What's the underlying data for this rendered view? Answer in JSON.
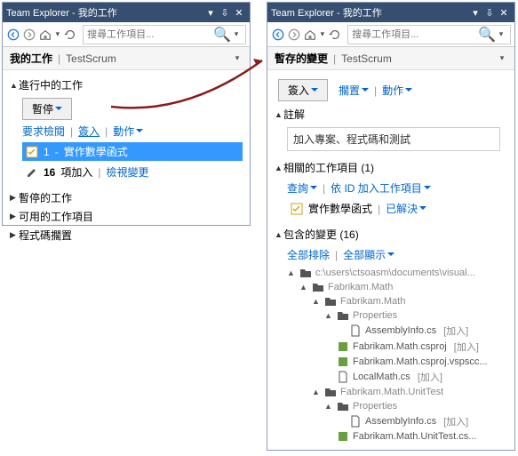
{
  "left": {
    "title": "Team Explorer - 我的工作",
    "search_placeholder": "搜尋工作項目...",
    "page_title": "我的工作",
    "context": "TestScrum",
    "in_progress": {
      "label": "進行中的工作",
      "suspend_btn": "暫停",
      "request_review": "要求檢閱",
      "checkin": "簽入",
      "actions": "動作",
      "item_id": "1",
      "item_title": "實作數學函式",
      "adds_count": "16",
      "adds_label": "項加入",
      "view_changes": "檢視變更"
    },
    "suspended": "暫停的工作",
    "available": "可用的工作項目",
    "shelvesets": "程式碼擱置"
  },
  "right": {
    "title": "Team Explorer - 我的工作",
    "search_placeholder": "搜尋工作項目...",
    "page_title": "暫存的變更",
    "context": "TestScrum",
    "checkin_btn": "簽入",
    "shelve": "擱置",
    "actions": "動作",
    "comment_label": "註解",
    "comment_value": "加入專案、程式碼和測試",
    "related_label": "相關的工作項目",
    "related_count": "(1)",
    "query": "查詢",
    "add_by_id": "依 ID 加入工作項目",
    "rel_item": "實作數學函式",
    "resolved": "已解決",
    "included_label": "包含的變更",
    "included_count": "(16)",
    "exclude_all": "全部排除",
    "show_all": "全部顯示",
    "tree": {
      "root": "c:\\users\\ctsoasm\\documents\\visual...",
      "n1": "Fabrikam.Math",
      "n2": "Fabrikam.Math",
      "n3": "Properties",
      "f1": "AssemblyInfo.cs",
      "f2": "Fabrikam.Math.csproj",
      "f3": "Fabrikam.Math.csproj.vspscc...",
      "f4": "LocalMath.cs",
      "n4": "Fabrikam.Math.UnitTest",
      "n5": "Properties",
      "f5": "AssemblyInfo.cs",
      "f6": "Fabrikam.Math.UnitTest.cs...",
      "add_tag": "[加入]"
    }
  }
}
